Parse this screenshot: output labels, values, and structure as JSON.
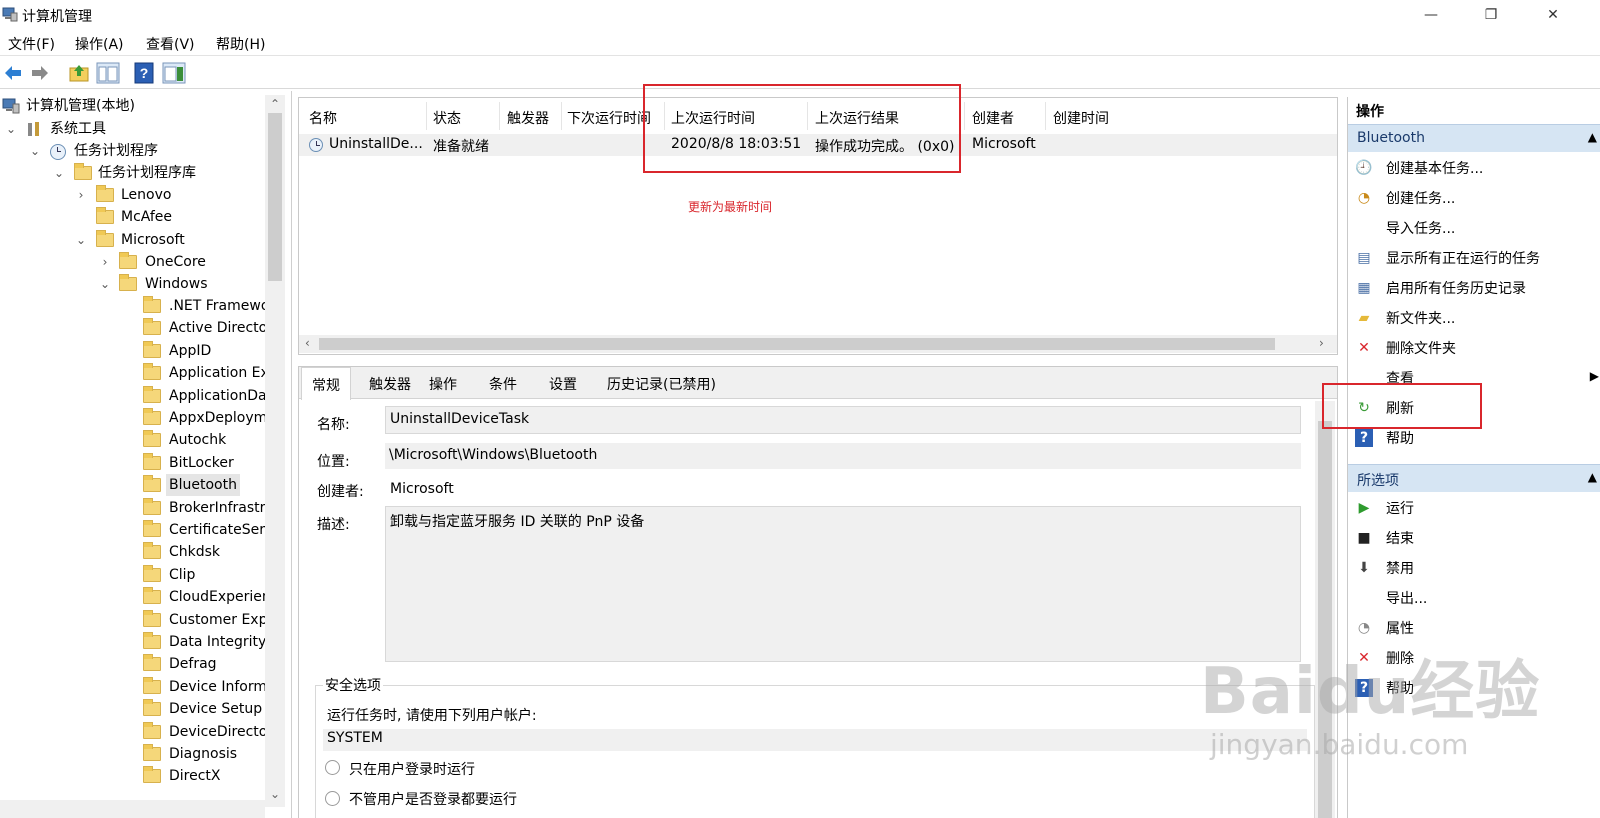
{
  "window": {
    "title": "计算机管理",
    "minimize": "—",
    "maximize": "❐",
    "close": "✕"
  },
  "menu": [
    "文件(F)",
    "操作(A)",
    "查看(V)",
    "帮助(H)"
  ],
  "toolbar": [
    "back-arrow",
    "forward-arrow",
    "up-folder",
    "show-hide-console-tree",
    "help",
    "show-hide-action-pane"
  ],
  "tree": {
    "root": "计算机管理(本地)",
    "system_tools": "系统工具",
    "task_scheduler": "任务计划程序",
    "task_library": "任务计划程序库",
    "lenovo": "Lenovo",
    "mcafee": "McAfee",
    "microsoft": "Microsoft",
    "onecore": "OneCore",
    "windows": "Windows",
    "windows_children": [
      ".NET Framewo",
      "Active Directo",
      "AppID",
      "Application Exp",
      "ApplicationDat",
      "AppxDeploym",
      "Autochk",
      "BitLocker",
      "Bluetooth",
      "BrokerInfrastru",
      "CertificateServ",
      "Chkdsk",
      "Clip",
      "CloudExperien",
      "Customer Expe",
      "Data Integrity S",
      "Defrag",
      "Device Inform",
      "Device Setup",
      "DeviceDirecto",
      "Diagnosis",
      "DirectX"
    ]
  },
  "task_list": {
    "columns": [
      "名称",
      "状态",
      "触发器",
      "下次运行时间",
      "上次运行时间",
      "上次运行结果",
      "创建者",
      "创建时间"
    ],
    "rows": [
      {
        "name": "UninstallDe...",
        "status": "准备就绪",
        "trigger": "",
        "next_run": "",
        "last_run": "2020/8/8 18:03:51",
        "last_result": "操作成功完成。 (0x0)",
        "author": "Microsoft",
        "created": ""
      }
    ],
    "annotation": "更新为最新时间"
  },
  "details": {
    "tabs": [
      "常规",
      "触发器",
      "操作",
      "条件",
      "设置",
      "历史记录(已禁用)"
    ],
    "name_label": "名称:",
    "name_value": "UninstallDeviceTask",
    "location_label": "位置:",
    "location_value": "\\Microsoft\\Windows\\Bluetooth",
    "author_label": "创建者:",
    "author_value": "Microsoft",
    "description_label": "描述:",
    "description_value": "卸载与指定蓝牙服务 ID 关联的 PnP 设备",
    "security_title": "安全选项",
    "run_as_text": "运行任务时, 请使用下列用户帐户:",
    "run_as_account": "SYSTEM",
    "radio_1": "只在用户登录时运行",
    "radio_2": "不管用户是否登录都要运行"
  },
  "actions": {
    "title": "操作",
    "section_1": "Bluetooth",
    "items_1": [
      {
        "icon": "basic-task-icon",
        "label": "创建基本任务..."
      },
      {
        "icon": "create-task-icon",
        "label": "创建任务..."
      },
      {
        "icon": "",
        "label": "导入任务..."
      },
      {
        "icon": "running-tasks-icon",
        "label": "显示所有正在运行的任务"
      },
      {
        "icon": "history-icon",
        "label": "启用所有任务历史记录"
      },
      {
        "icon": "new-folder-icon",
        "label": "新文件夹..."
      },
      {
        "icon": "delete-folder-icon",
        "label": "删除文件夹"
      },
      {
        "icon": "",
        "label": "查看"
      },
      {
        "icon": "refresh-icon",
        "label": "刷新"
      },
      {
        "icon": "help-icon",
        "label": "帮助"
      }
    ],
    "section_2": "所选项",
    "items_2": [
      {
        "icon": "run-icon",
        "label": "运行"
      },
      {
        "icon": "end-icon",
        "label": "结束"
      },
      {
        "icon": "disable-icon",
        "label": "禁用"
      },
      {
        "icon": "",
        "label": "导出..."
      },
      {
        "icon": "properties-icon",
        "label": "属性"
      },
      {
        "icon": "delete-icon",
        "label": "删除"
      },
      {
        "icon": "help-icon",
        "label": "帮助"
      }
    ]
  },
  "watermark": {
    "logo": "Baidu经验",
    "url": "jingyan.baidu.com"
  },
  "colors": {
    "annotation_red": "#d9262c",
    "section_blue": "#d6e5f3",
    "selection_gray": "#e5e5e5"
  }
}
